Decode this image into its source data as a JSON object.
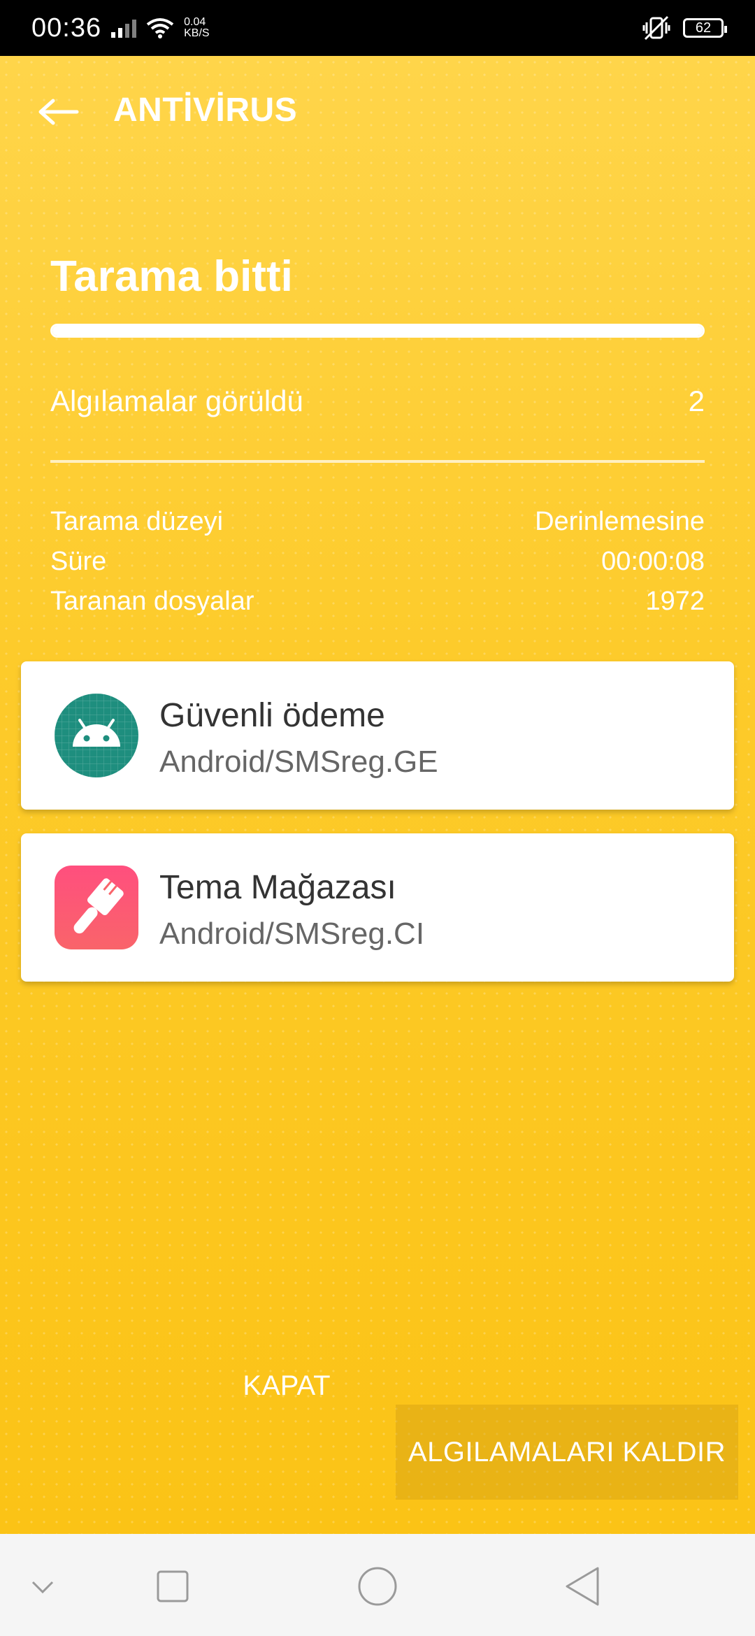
{
  "status_bar": {
    "time": "00:36",
    "net_speed_value": "0.04",
    "net_speed_unit": "KB/S",
    "battery": "62"
  },
  "header": {
    "title": "ANTİVİRUS"
  },
  "scan": {
    "title": "Tarama bitti",
    "progress_percent": 100,
    "detections_label": "Algılamalar görüldü",
    "detections_count": "2"
  },
  "stats": [
    {
      "label": "Tarama düzeyi",
      "value": "Derinlemesine"
    },
    {
      "label": "Süre",
      "value": "00:00:08"
    },
    {
      "label": "Taranan dosyalar",
      "value": "1972"
    }
  ],
  "detections": [
    {
      "app_name": "Güvenli ödeme",
      "threat": "Android/SMSreg.GE",
      "icon": "android-icon",
      "icon_color": "#1E8E7E"
    },
    {
      "app_name": "Tema Mağazası",
      "threat": "Android/SMSreg.CI",
      "icon": "paint-brush-icon",
      "icon_color": "#F7506E"
    }
  ],
  "buttons": {
    "close_label": "KAPAT",
    "remove_label": "ALGILAMALARI KALDIR"
  },
  "colors": {
    "background": "#FDCB2B",
    "text_primary": "#FFFFFF",
    "card_background": "#FFFFFF"
  }
}
